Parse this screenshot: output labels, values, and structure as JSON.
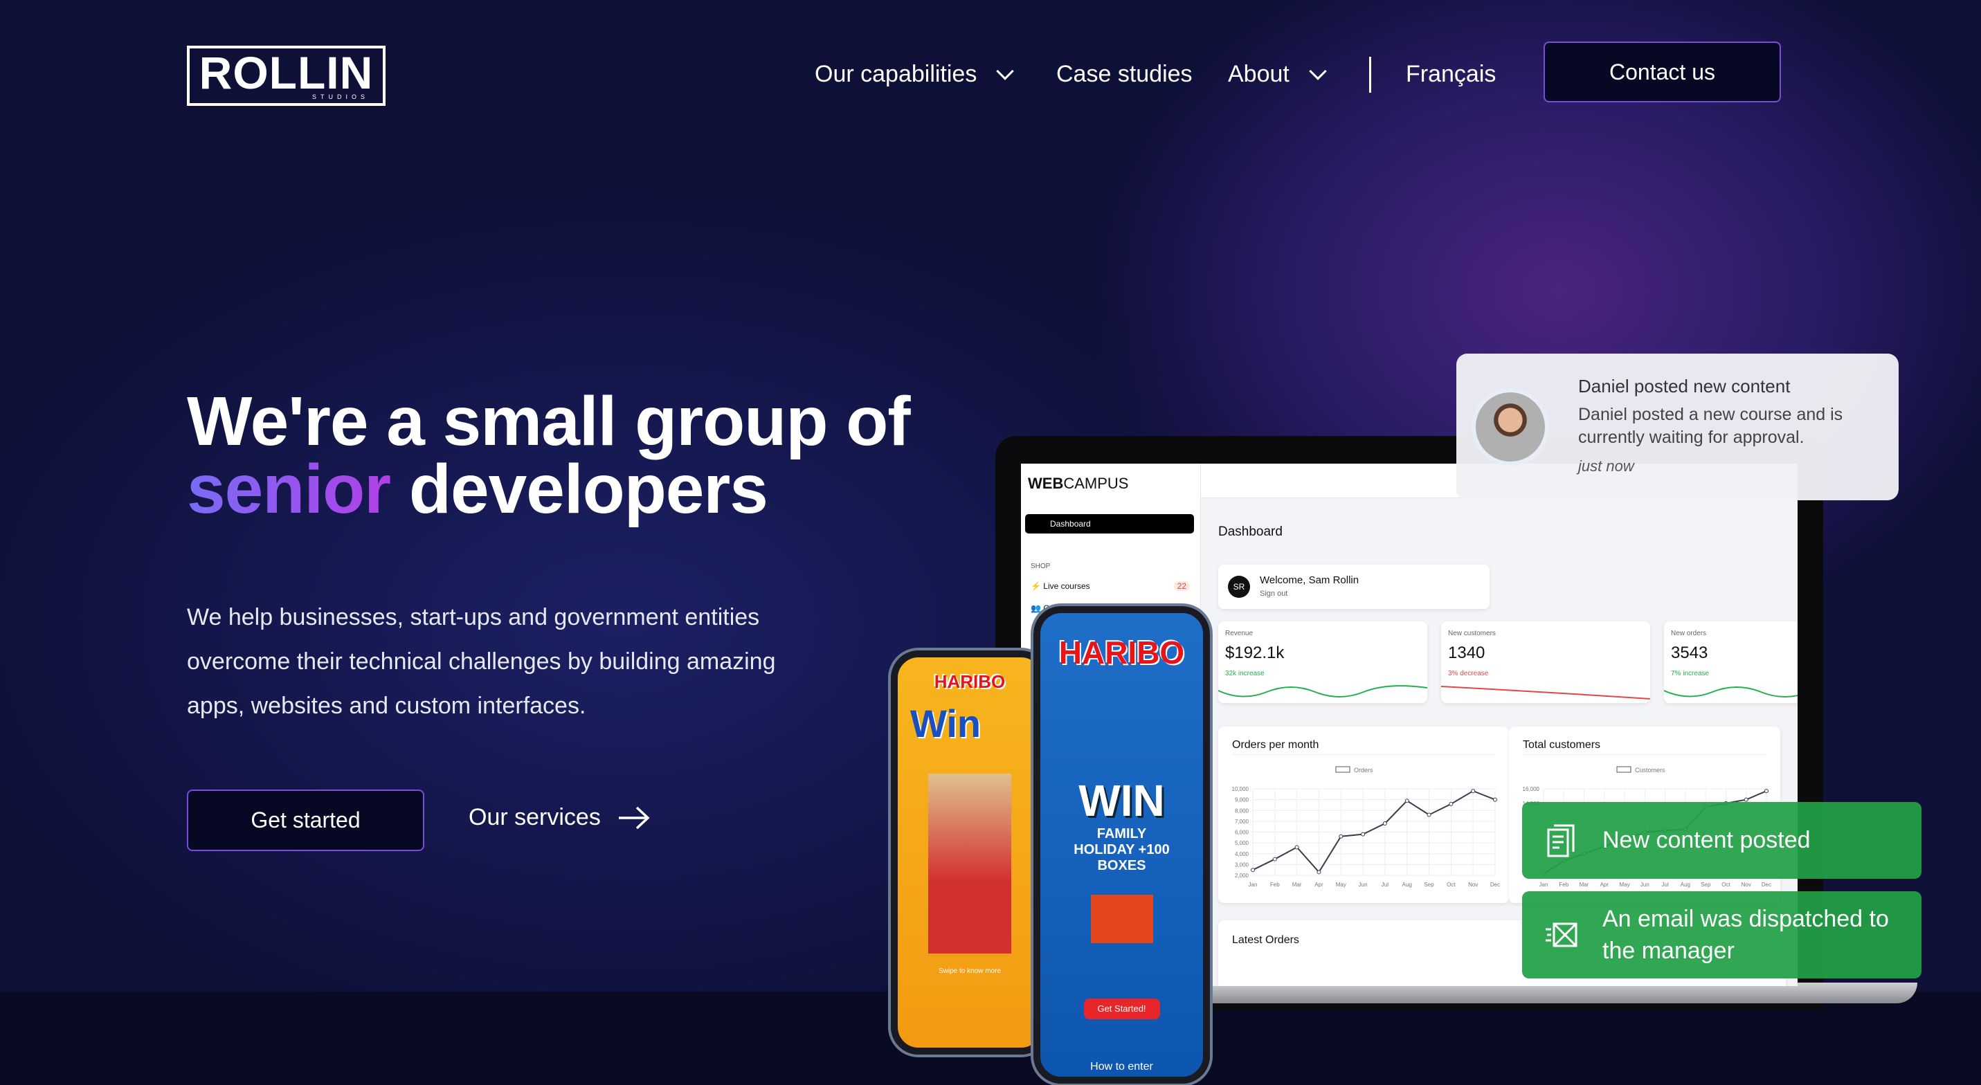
{
  "header": {
    "logo": "ROLLIN",
    "logo_sub": "STUDIOS",
    "nav": [
      {
        "label": "Our capabilities",
        "dropdown": true
      },
      {
        "label": "Case studies"
      },
      {
        "label": "About",
        "dropdown": true
      },
      {
        "label": "Français"
      }
    ],
    "contact": "Contact us"
  },
  "hero": {
    "line1": "We're a small group of",
    "accent": "senior",
    "line2_rest": " developers",
    "paragraph": "We help businesses, start-ups and government entities overcome their technical challenges by building amazing apps, websites and custom interfaces.",
    "primary": "Get started",
    "secondary": "Our services",
    "accent_color": "#9b55f0"
  },
  "dashboard": {
    "brand_bold": "WEB",
    "brand_rest": "CAMPUS",
    "menu_active": "Dashboard",
    "section": "SHOP",
    "items": [
      {
        "label": "Live courses",
        "badge": "22"
      },
      {
        "label": "Customers"
      }
    ],
    "title": "Dashboard",
    "welcome": "Welcome, Sam Rollin",
    "initials": "SR",
    "signout": "Sign out",
    "stats": [
      {
        "label": "Revenue",
        "value": "$192.1k",
        "change": "32k increase",
        "trend": "up"
      },
      {
        "label": "New customers",
        "value": "1340",
        "change": "3% decrease",
        "trend": "down"
      },
      {
        "label": "New orders",
        "value": "3543",
        "change": "7% increase",
        "trend": "up"
      }
    ],
    "orders_chart": {
      "title": "Orders per month",
      "legend": "Orders",
      "months": [
        "Jan",
        "Feb",
        "Mar",
        "Apr",
        "May",
        "Jun",
        "Jul",
        "Aug",
        "Sep",
        "Oct",
        "Nov",
        "Dec"
      ],
      "yticks": [
        "10,000",
        "9,000",
        "8,000",
        "7,000",
        "6,000",
        "5,000",
        "4,000",
        "3,000",
        "2,000"
      ],
      "ylim": [
        2000,
        10000
      ],
      "values": [
        2500,
        3500,
        4600,
        2300,
        5600,
        5800,
        6800,
        8900,
        7600,
        8600,
        9800,
        9000
      ]
    },
    "customers_chart": {
      "title": "Total customers",
      "legend": "Customers",
      "months": [
        "Jan",
        "Feb",
        "Mar",
        "Apr",
        "May",
        "Jun",
        "Jul",
        "Aug",
        "Sep",
        "Oct",
        "Nov",
        "Dec"
      ],
      "yticks": [
        "16,000",
        "14,000"
      ],
      "ylim": [
        4000,
        16000
      ],
      "values": [
        4200,
        6000,
        7000,
        8000,
        9000,
        10000,
        10200,
        10400,
        13500,
        14000,
        14500,
        15700
      ]
    },
    "latest": "Latest Orders"
  },
  "notification": {
    "title": "Daniel posted new content",
    "body": "Daniel posted a new course and is currently waiting for approval.",
    "time": "just now"
  },
  "toasts": [
    {
      "icon": "document-icon",
      "text": "New content posted"
    },
    {
      "icon": "email-sent-icon",
      "text": "An email was dispatched to the manager"
    }
  ],
  "phones": {
    "brand": "HARIBO",
    "left_win": "Win",
    "right_win": "WIN",
    "right_sub": "FAMILY HOLIDAY +100 BOXES",
    "cta": "Get Started!",
    "how": "How to enter",
    "swipe": "Swipe to know more"
  }
}
